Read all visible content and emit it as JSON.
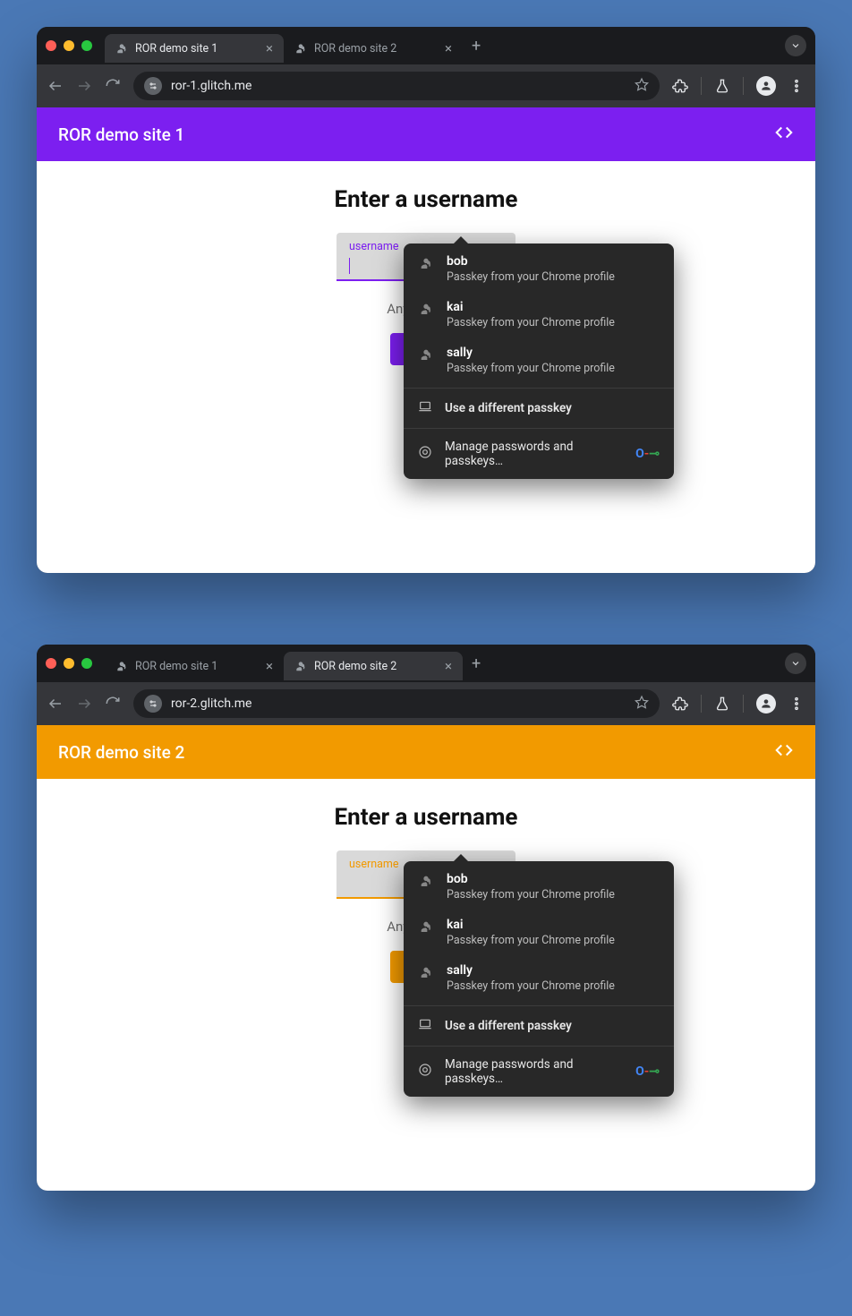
{
  "windows": [
    {
      "traffic": true,
      "tabs": [
        {
          "label": "ROR demo site 1",
          "active": true
        },
        {
          "label": "ROR demo site 2",
          "active": false
        }
      ],
      "address": "ror-1.glitch.me",
      "app_header": "ROR demo site 1",
      "accent": "purple",
      "page_title": "Enter a username",
      "input_label": "username",
      "input_value": "",
      "helper_text": "Any usernam",
      "show_caret": true
    },
    {
      "traffic": true,
      "tabs": [
        {
          "label": "ROR demo site 1",
          "active": false
        },
        {
          "label": "ROR demo site 2",
          "active": true
        }
      ],
      "address": "ror-2.glitch.me",
      "app_header": "ROR demo site 2",
      "accent": "orange",
      "page_title": "Enter a username",
      "input_label": "username",
      "input_value": "",
      "helper_text": "Any usernam",
      "show_caret": false
    }
  ],
  "passkey_popup": {
    "entries": [
      {
        "name": "bob",
        "sub": "Passkey from your Chrome profile"
      },
      {
        "name": "kai",
        "sub": "Passkey from your Chrome profile"
      },
      {
        "name": "sally",
        "sub": "Passkey from your Chrome profile"
      }
    ],
    "different": "Use a different passkey",
    "manage": "Manage passwords and passkeys…"
  },
  "colors": {
    "purple": "#7c1ff0",
    "orange": "#f29a00"
  }
}
